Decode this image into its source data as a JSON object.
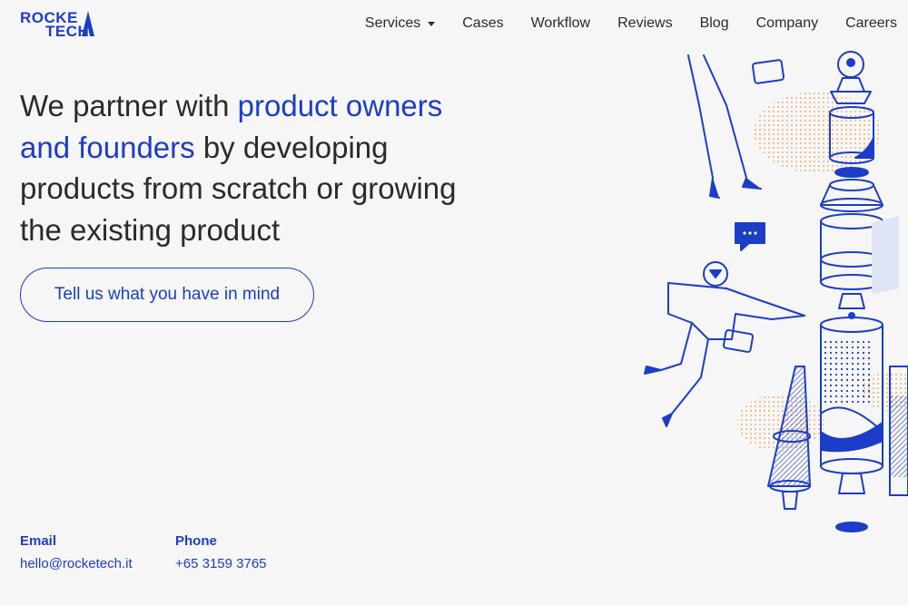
{
  "brand": {
    "line1": "ROCKE",
    "line2": "TECH",
    "color": "#1c3dc7"
  },
  "nav": {
    "items": [
      "Services",
      "Cases",
      "Workflow",
      "Reviews",
      "Blog",
      "Company",
      "Careers"
    ]
  },
  "hero": {
    "part1": "We partner with ",
    "highlight": "product owners and founders",
    "part2": " by developing products from scratch or growing the existing product"
  },
  "cta": {
    "label": "Tell us what you have in mind"
  },
  "contact": {
    "email_label": "Email",
    "email": "hello@rocketech.it",
    "phone_label": "Phone",
    "phone": "+65 3159 3765"
  },
  "illustration": {
    "icon": "rocket-assembly-illustration",
    "accent": "#1c3dc7",
    "dots": "#f0b070"
  }
}
